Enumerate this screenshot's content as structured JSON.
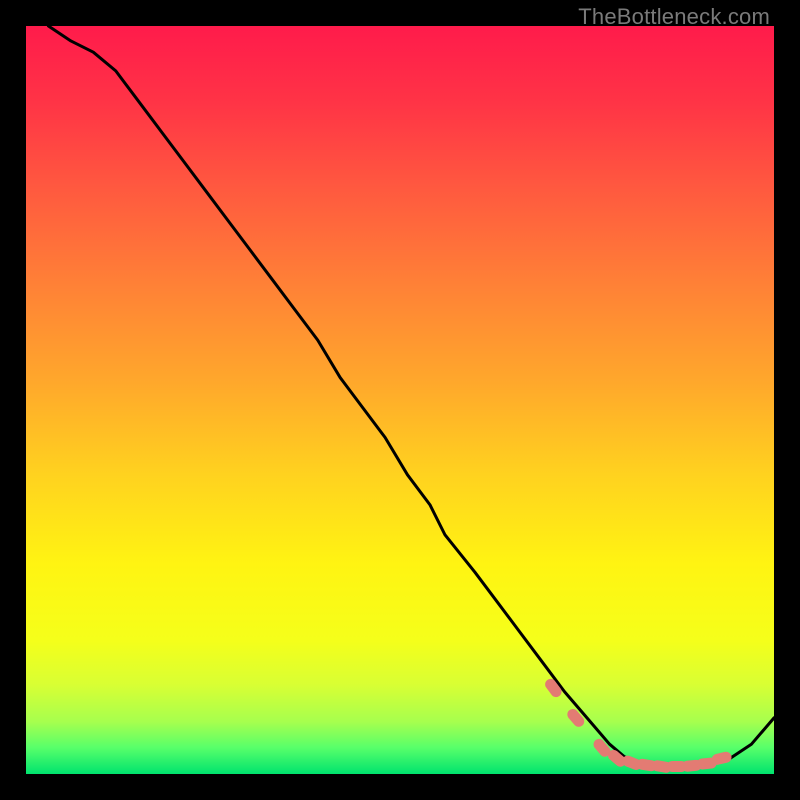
{
  "watermark": "TheBottleneck.com",
  "chart_data": {
    "type": "line",
    "title": "",
    "xlabel": "",
    "ylabel": "",
    "xlim": [
      0,
      100
    ],
    "ylim": [
      0,
      100
    ],
    "x": [
      3,
      6,
      9,
      12,
      15,
      18,
      21,
      24,
      27,
      30,
      33,
      36,
      39,
      42,
      45,
      48,
      51,
      54,
      56,
      60,
      63,
      66,
      69,
      72,
      75,
      78,
      80,
      82,
      85,
      88,
      91,
      94,
      97,
      100
    ],
    "y": [
      100,
      98,
      96.5,
      94,
      90,
      86,
      82,
      78,
      74,
      70,
      66,
      62,
      58,
      53,
      49,
      45,
      40,
      36,
      32,
      27,
      23,
      19,
      15,
      11,
      7.5,
      4,
      2.3,
      1.5,
      1,
      1,
      1.3,
      2,
      4,
      7.5
    ],
    "markers": {
      "x": [
        70.5,
        73.5,
        77,
        79,
        81,
        83,
        85,
        87,
        89,
        91,
        93
      ],
      "y": [
        11.5,
        7.5,
        3.5,
        2.1,
        1.5,
        1.2,
        1,
        1,
        1.1,
        1.4,
        2.1
      ]
    },
    "gradient_hint": "vertical red-orange-yellow-green",
    "background": "#000000"
  }
}
